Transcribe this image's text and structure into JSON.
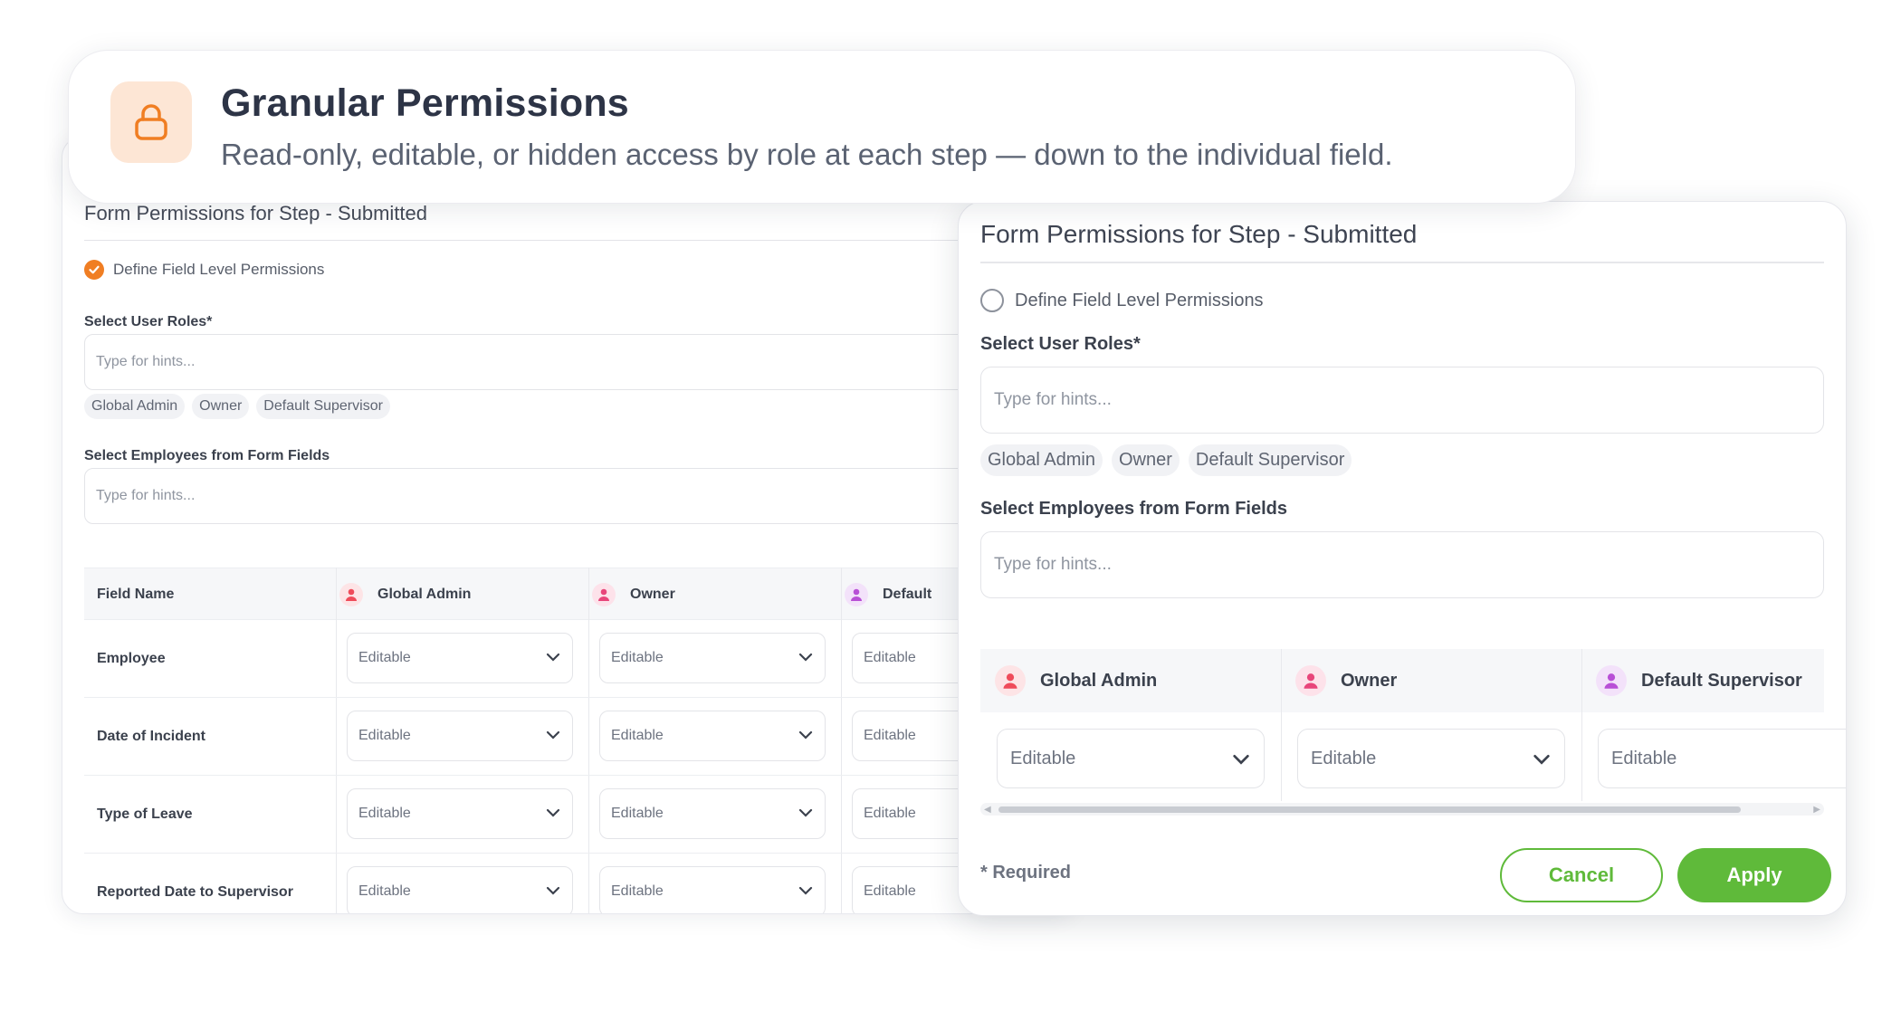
{
  "hero": {
    "title": "Granular Permissions",
    "subtitle": "Read-only, editable, or hidden access by role at each step — down to the individual field.",
    "icon": "lock-icon",
    "accent": "#f07e23"
  },
  "back_panel": {
    "title": "Form Permissions for Step - Submitted",
    "field_level_label": "Define Field Level Permissions",
    "field_level_checked": true,
    "roles_label": "Select User Roles*",
    "roles_placeholder": "Type for hints...",
    "roles": [
      "Global Admin",
      "Owner",
      "Default Supervisor"
    ],
    "employees_label": "Select Employees from Form Fields",
    "employees_placeholder": "Type for hints...",
    "table": {
      "columns": [
        "Field Name",
        "Global Admin",
        "Owner",
        "Default"
      ],
      "rows": [
        {
          "name": "Employee",
          "values": [
            "Editable",
            "Editable",
            "Editable"
          ]
        },
        {
          "name": "Date of Incident",
          "values": [
            "Editable",
            "Editable",
            "Editable"
          ]
        },
        {
          "name": "Type of Leave",
          "values": [
            "Editable",
            "Editable",
            "Editable"
          ]
        },
        {
          "name": "Reported Date to Supervisor",
          "values": [
            "Editable",
            "Editable",
            "Editable"
          ]
        }
      ]
    }
  },
  "front_panel": {
    "title": "Form Permissions for Step - Submitted",
    "field_level_label": "Define Field Level Permissions",
    "field_level_checked": false,
    "roles_label": "Select User Roles*",
    "roles_placeholder": "Type for hints...",
    "roles": [
      "Global Admin",
      "Owner",
      "Default Supervisor"
    ],
    "employees_label": "Select Employees from Form Fields",
    "employees_placeholder": "Type for hints...",
    "table": {
      "columns": [
        "Global Admin",
        "Owner",
        "Default Supervisor"
      ],
      "values": [
        "Editable",
        "Editable",
        "Editable"
      ]
    },
    "required_note": "* Required",
    "cancel_label": "Cancel",
    "apply_label": "Apply"
  },
  "colors": {
    "primary_green": "#5fba3a",
    "avatar_red": "#ef4b5a",
    "avatar_pink": "#e8457a",
    "avatar_purple": "#b84fd6"
  }
}
